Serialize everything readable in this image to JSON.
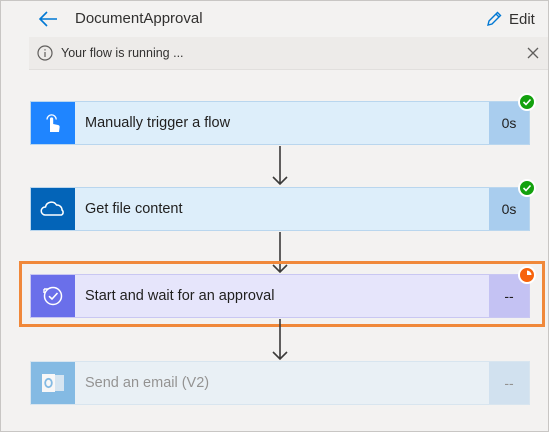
{
  "header": {
    "title": "DocumentApproval",
    "edit_label": "Edit"
  },
  "notification": {
    "message": "Your flow is running ...",
    "icon": "info-icon"
  },
  "steps": [
    {
      "label": "Manually trigger a flow",
      "duration": "0s",
      "icon": "touch-icon",
      "status": "succeeded",
      "accent": "#1f85ff"
    },
    {
      "label": "Get file content",
      "duration": "0s",
      "icon": "onedrive-icon",
      "status": "succeeded",
      "accent": "#0364b8"
    },
    {
      "label": "Start and wait for an approval",
      "duration": "--",
      "icon": "approval-icon",
      "status": "running",
      "accent": "#6a6fea"
    },
    {
      "label": "Send an email (V2)",
      "duration": "--",
      "icon": "outlook-icon",
      "status": "not-started",
      "accent": "#0078d4"
    }
  ],
  "colors": {
    "success": "#13a10e",
    "running": "#f7630c",
    "highlight": "#f0883a"
  }
}
